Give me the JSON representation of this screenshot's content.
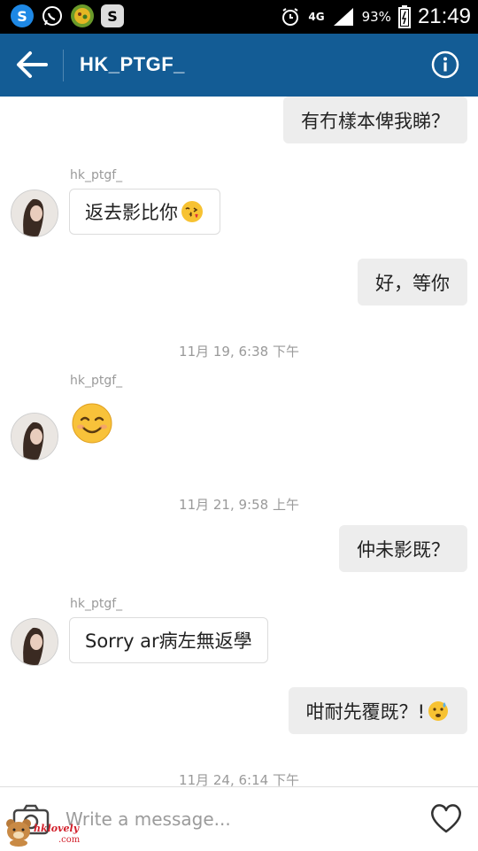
{
  "status_bar": {
    "network": "4G",
    "battery": "93%",
    "time": "21:49"
  },
  "header": {
    "title": "HK_PTGF_"
  },
  "messages": [
    {
      "type": "outgoing",
      "text": "有冇樣本俾我睇？"
    },
    {
      "type": "incoming",
      "sender": "hk_ptgf_",
      "text": "返去影比你",
      "emoji": "kissing-heart-emoji"
    },
    {
      "type": "outgoing",
      "text": "好，等你"
    },
    {
      "type": "timestamp",
      "text": "11月 19, 6:38 下午"
    },
    {
      "type": "incoming",
      "sender": "hk_ptgf_",
      "emoji": "smiling-face-emoji"
    },
    {
      "type": "timestamp",
      "text": "11月 21, 9:58 上午"
    },
    {
      "type": "outgoing",
      "text": "仲未影既？"
    },
    {
      "type": "incoming",
      "sender": "hk_ptgf_",
      "text": "Sorry ar病左無返學"
    },
    {
      "type": "outgoing",
      "text": "咁耐先覆既？!",
      "emoji": "anxious-sweat-emoji"
    },
    {
      "type": "timestamp",
      "text": "11月 24, 6:14 下午"
    }
  ],
  "input": {
    "placeholder": "Write a message..."
  },
  "watermark": {
    "text": "hklovely",
    "suffix": ".com"
  },
  "colors": {
    "header": "#135c95",
    "outgoing_bubble": "#ededed",
    "timestamp": "#9a9a9a"
  }
}
